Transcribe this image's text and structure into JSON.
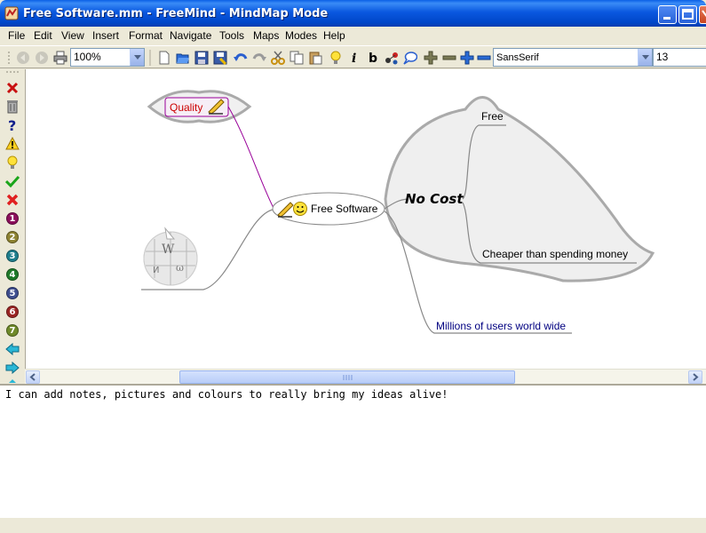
{
  "window": {
    "title": "Free Software.mm - FreeMind - MindMap Mode"
  },
  "menu": [
    "File",
    "Edit",
    "View",
    "Insert",
    "Format",
    "Navigate",
    "Tools",
    "Maps",
    "Modes",
    "Help"
  ],
  "toolbar": {
    "zoom": "100%",
    "font_family": "SansSerif",
    "font_size": "13"
  },
  "left_icons": [
    "delete-icon",
    "trash-icon",
    "question-icon",
    "warning-icon",
    "idea-icon",
    "check-icon",
    "cross-icon",
    {
      "number": "1",
      "color": "#8b0f5b"
    },
    {
      "number": "2",
      "color": "#8d8231"
    },
    {
      "number": "3",
      "color": "#1e7e8c"
    },
    {
      "number": "4",
      "color": "#207b2a"
    },
    {
      "number": "5",
      "color": "#3e4e8e"
    },
    {
      "number": "6",
      "color": "#9b2625"
    },
    {
      "number": "7",
      "color": "#6f8a2a"
    },
    "back-arrow-icon",
    "forward-arrow-icon"
  ],
  "mindmap": {
    "root": "Free Software",
    "nodes": {
      "quality": {
        "label": "Quality",
        "color": "#cc0000"
      },
      "no_cost": {
        "label": "No Cost"
      },
      "free": {
        "label": "Free"
      },
      "cheaper": {
        "label": "Cheaper than spending money"
      },
      "millions": {
        "label": "Millions of users world wide",
        "color": "#000080"
      }
    },
    "link_color": "#990099"
  },
  "notes": {
    "text": "I can add notes, pictures and colours to really bring my ideas alive!"
  }
}
